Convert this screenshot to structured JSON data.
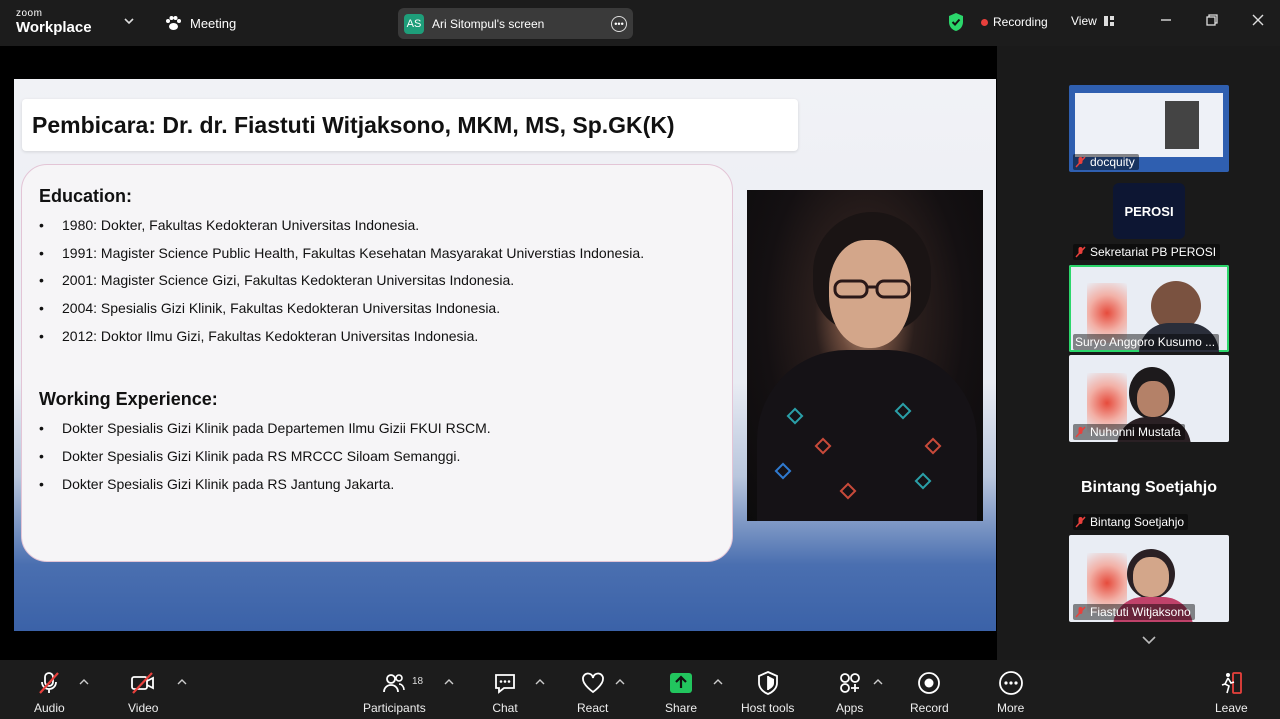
{
  "app": {
    "brand_top": "zoom",
    "brand_bottom": "Workplace",
    "meeting_label": "Meeting"
  },
  "share": {
    "initials": "AS",
    "label": "Ari Sitompul's screen"
  },
  "status": {
    "recording": "Recording",
    "view": "View"
  },
  "slide": {
    "title": "Pembicara: Dr. dr. Fiastuti Witjaksono, MKM, MS, Sp.GK(K)",
    "education_heading": "Education:",
    "education": [
      "1980: Dokter, Fakultas Kedokteran Universitas Indonesia.",
      "1991: Magister Science Public Health, Fakultas Kesehatan Masyarakat Universtias Indonesia.",
      "2001: Magister Science Gizi, Fakultas Kedokteran Universitas Indonesia.",
      "2004: Spesialis Gizi Klinik, Fakultas Kedokteran Universitas Indonesia.",
      "2012: Doktor Ilmu Gizi, Fakultas Kedokteran Universitas Indonesia."
    ],
    "work_heading": "Working Experience:",
    "work": [
      "Dokter Spesialis Gizi Klinik pada Departemen Ilmu Gizii FKUI RSCM.",
      "Dokter Spesialis Gizi Klinik pada RS MRCCC Siloam Semanggi.",
      "Dokter Spesialis Gizi Klinik pada RS Jantung Jakarta."
    ],
    "bullet": "•"
  },
  "participants_panel": [
    {
      "name": "docquity",
      "muted": true
    },
    {
      "name": "Sekretariat PB PEROSI",
      "muted": true,
      "logo_text": "PEROSI"
    },
    {
      "name": "Suryo Anggoro Kusumo ...",
      "muted": false,
      "active": true
    },
    {
      "name": "Nuhonni Mustafa",
      "muted": true
    },
    {
      "name": "Bintang Soetjahjo",
      "muted": true,
      "display_name": "Bintang Soetjahjo"
    },
    {
      "name": "Fiastuti Witjaksono",
      "muted": true
    }
  ],
  "toolbar": {
    "audio": "Audio",
    "video": "Video",
    "participants": "Participants",
    "participants_count": "18",
    "chat": "Chat",
    "react": "React",
    "share": "Share",
    "host_tools": "Host tools",
    "apps": "Apps",
    "record": "Record",
    "more": "More",
    "leave": "Leave"
  },
  "colors": {
    "accent_green": "#2bd66b",
    "share_green": "#22c55e",
    "mute_red": "#e8403c",
    "tile_border": "#e3c5d6"
  }
}
